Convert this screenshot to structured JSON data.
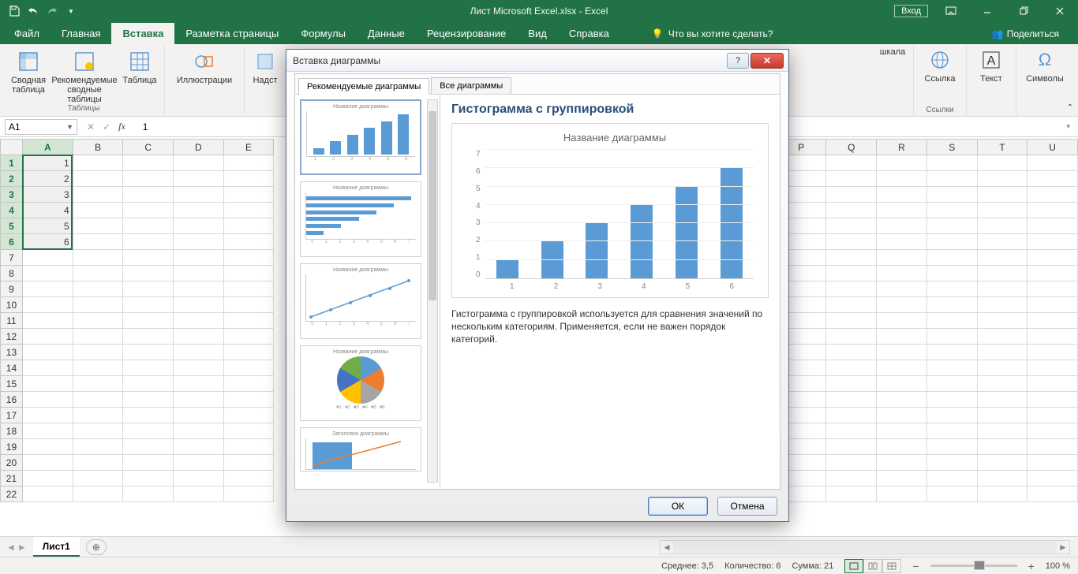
{
  "title": "Лист Microsoft Excel.xlsx  -  Excel",
  "login_btn": "Вход",
  "ribbon_tabs": {
    "file": "Файл",
    "home": "Главная",
    "insert": "Вставка",
    "layout": "Разметка страницы",
    "formulas": "Формулы",
    "data": "Данные",
    "review": "Рецензирование",
    "view": "Вид",
    "help": "Справка",
    "tellme": "Что вы хотите сделать?",
    "share": "Поделиться"
  },
  "ribbon_groups": {
    "tables_label": "Таблицы",
    "pivot": "Сводная таблица",
    "recommended_pivot": "Рекомендуемые сводные таблицы",
    "table": "Таблица",
    "illustrations": "Иллюстрации",
    "addins": "Надст",
    "scale_frag": "шкала",
    "link": "Ссылка",
    "links_label": "Ссылки",
    "text": "Текст",
    "symbols": "Символы"
  },
  "namebox": "A1",
  "formula_value": "1",
  "columns": [
    "A",
    "B",
    "C",
    "D",
    "E",
    "P",
    "Q",
    "R",
    "S",
    "T",
    "U"
  ],
  "row_numbers": [
    1,
    2,
    3,
    4,
    5,
    6,
    7,
    8,
    9,
    10,
    11,
    12,
    13,
    14,
    15,
    16,
    17,
    18,
    19,
    20,
    21,
    22
  ],
  "cells": {
    "A1": "1",
    "A2": "2",
    "A3": "3",
    "A4": "4",
    "A5": "5",
    "A6": "6"
  },
  "sheet_tab": "Лист1",
  "status": {
    "avg_label": "Среднее:",
    "avg": "3,5",
    "count_label": "Количество:",
    "count": "6",
    "sum_label": "Сумма:",
    "sum": "21",
    "zoom": "100 %"
  },
  "dialog": {
    "title": "Вставка диаграммы",
    "tab_recommended": "Рекомендуемые диаграммы",
    "tab_all": "Все диаграммы",
    "thumb_title": "Название диаграммы",
    "thumb_title_combo": "Заголовок диаграммы",
    "type_title": "Гистограмма с группировкой",
    "chart_title": "Название диаграммы",
    "description": "Гистограмма с группировкой используется для сравнения значений по нескольким категориям. Применяется, если не важен порядок категорий.",
    "ok": "ОК",
    "cancel": "Отмена"
  },
  "chart_data": {
    "type": "bar",
    "title": "Название диаграммы",
    "categories": [
      1,
      2,
      3,
      4,
      5,
      6
    ],
    "values": [
      1,
      2,
      3,
      4,
      5,
      6
    ],
    "xlabel": "",
    "ylabel": "",
    "ylim": [
      0,
      7
    ],
    "yticks": [
      0,
      1,
      2,
      3,
      4,
      5,
      6,
      7
    ]
  }
}
